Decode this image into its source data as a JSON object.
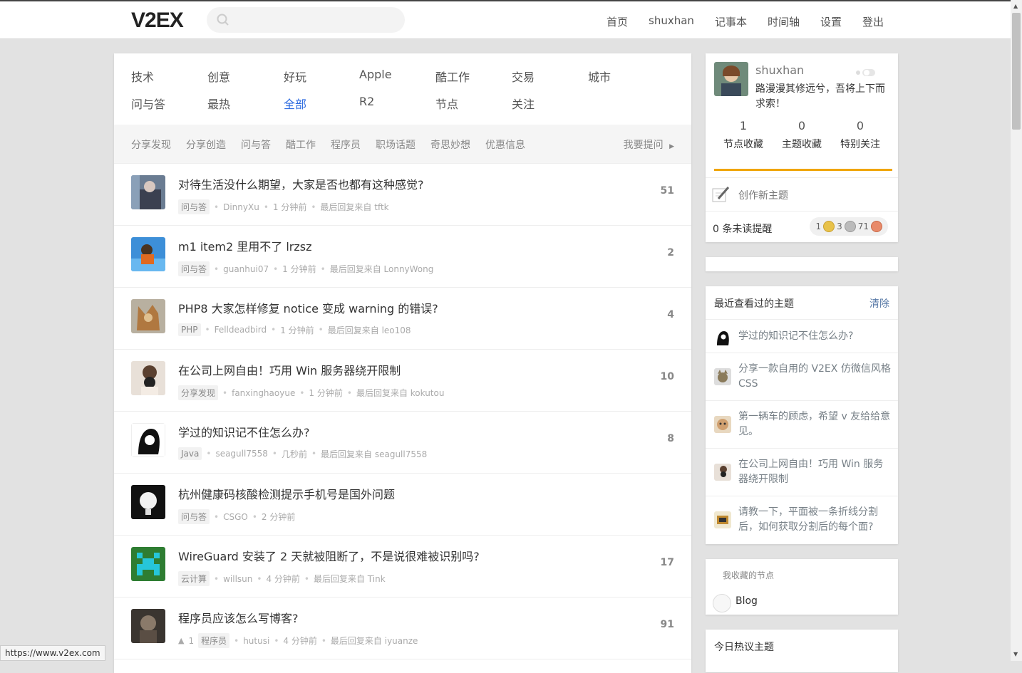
{
  "header": {
    "logo": "V2EX",
    "search_placeholder": "",
    "nav": [
      "首页",
      "shuxhan",
      "记事本",
      "时间轴",
      "设置",
      "登出"
    ]
  },
  "tabs": {
    "row1": [
      "技术",
      "创意",
      "好玩",
      "Apple",
      "酷工作",
      "交易",
      "城市"
    ],
    "row2": [
      "问与答",
      "最热",
      "全部",
      "R2",
      "节点",
      "关注"
    ],
    "active": "全部"
  },
  "subnav": {
    "items": [
      "分享发现",
      "分享创造",
      "问与答",
      "酷工作",
      "程序员",
      "职场话题",
      "奇思妙想",
      "优惠信息"
    ],
    "ask": "我要提问"
  },
  "topics": [
    {
      "title": "对待生活没什么期望，大家是否也都有这种感觉?",
      "node": "问与答",
      "author": "DinnyXu",
      "time": "1 分钟前",
      "last": "最后回复来自 tftk",
      "count": "51"
    },
    {
      "title": "m1 item2 里用不了 lrzsz",
      "node": "问与答",
      "author": "guanhui07",
      "time": "1 分钟前",
      "last": "最后回复来自 LonnyWong",
      "count": "2"
    },
    {
      "title": "PHP8 大家怎样修复 notice 变成 warning 的错误?",
      "node": "PHP",
      "author": "Felldeadbird",
      "time": "1 分钟前",
      "last": "最后回复来自 leo108",
      "count": "4"
    },
    {
      "title": "在公司上网自由！巧用 Win 服务器绕开限制",
      "node": "分享发现",
      "author": "fanxinghaoyue",
      "time": "1 分钟前",
      "last": "最后回复来自 kokutou",
      "count": "10"
    },
    {
      "title": "学过的知识记不住怎么办?",
      "node": "Java",
      "author": "seagull7558",
      "time": "几秒前",
      "last": "最后回复来自 seagull7558",
      "count": "8"
    },
    {
      "title": "杭州健康码核酸检测提示手机号是国外问题",
      "node": "问与答",
      "author": "CSGO",
      "time": "2 分钟前",
      "last": "",
      "count": ""
    },
    {
      "title": "WireGuard 安装了 2 天就被阻断了，不是说很难被识别吗?",
      "node": "云计算",
      "author": "willsun",
      "time": "4 分钟前",
      "last": "最后回复来自 Tink",
      "count": "17"
    },
    {
      "title": "程序员应该怎么写博客?",
      "node": "程序员",
      "author": "hutusi",
      "time": "4 分钟前",
      "last": "最后回复来自 iyuanze",
      "count": "91",
      "votes": "1"
    }
  ],
  "user": {
    "name": "shuxhan",
    "motto": "路漫漫其修远兮，吾将上下而求索！",
    "stats": [
      {
        "n": "1",
        "label": "节点收藏"
      },
      {
        "n": "0",
        "label": "主题收藏"
      },
      {
        "n": "0",
        "label": "特别关注"
      }
    ],
    "create": "创作新主题",
    "notifications": "0 条未读提醒",
    "coins": {
      "gold": "1",
      "silver": "3",
      "bronze": "71"
    }
  },
  "recent": {
    "title": "最近查看过的主题",
    "clear": "清除",
    "items": [
      "学过的知识记不住怎么办?",
      "分享一款自用的 V2EX 仿微信风格 CSS",
      "第一辆车的顾虑，希望 v 友给给意见。",
      "在公司上网自由！巧用 Win 服务器绕开限制",
      "请教一下，平面被一条折线分割后，如何获取分割后的每个面?"
    ]
  },
  "favorites": {
    "title": "我收藏的节点",
    "items": [
      "Blog"
    ]
  },
  "hot": {
    "title": "今日热议主题"
  },
  "status_url": "https://www.v2ex.com",
  "colors": {
    "accent": "#2d6be0",
    "progress": "#f0a500"
  }
}
